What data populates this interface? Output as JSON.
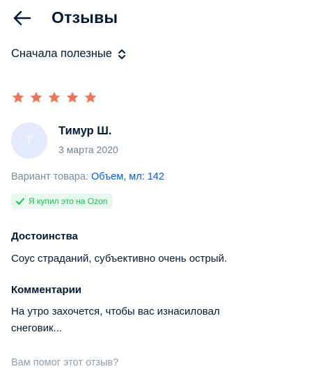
{
  "header": {
    "title": "Отзывы",
    "back_icon": "arrow-left-icon"
  },
  "sort": {
    "label": "Сначала полезные",
    "icon": "sort-chevrons-icon"
  },
  "review": {
    "rating": 5,
    "max_rating": 5,
    "star_color": "#f0735a",
    "author": {
      "initial": "Т",
      "name": "Тимур Ш.",
      "date": "3 марта 2020"
    },
    "variant": {
      "label": "Вариант товара:",
      "value": "Объем, мл: 142"
    },
    "verified_badge": {
      "text": "Я купил это на Ozon",
      "icon": "check-icon",
      "color": "#10c44c"
    },
    "pros": {
      "title": "Достоинства",
      "text": "Соус страданий, субъективно очень острый."
    },
    "comment": {
      "title": "Комментарии",
      "text": "На утро захочется, чтобы вас изнасиловал снеговик..."
    },
    "helpful_question": "Вам помог этот отзыв?"
  },
  "colors": {
    "link": "#005bff",
    "text": "#001a34",
    "muted": "#70818f",
    "avatar_bg": "#e4e9fb"
  }
}
